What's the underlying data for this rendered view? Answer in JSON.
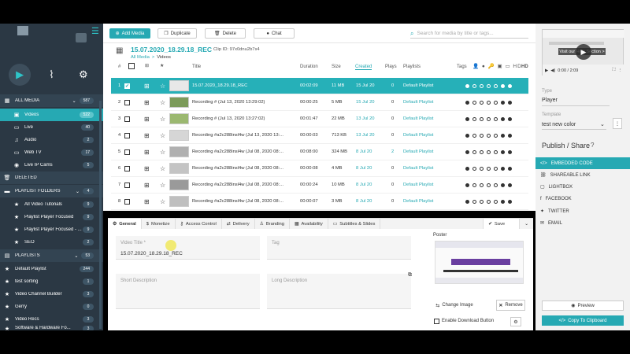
{
  "toolbar": {
    "add_label": "Add Media",
    "duplicate_label": "Duplicate",
    "delete_label": "Delete",
    "chat_label": "Chat",
    "search_placeholder": "Search for media by title or tags..."
  },
  "media": {
    "title": "15.07.2020_18.29.18_REC",
    "clip_id": "Clip ID: 97x0dnu2b7s4",
    "breadcrumb_root": "All Media",
    "breadcrumb_sep": ">",
    "breadcrumb_current": "Videos"
  },
  "table": {
    "headers": {
      "num": "#",
      "title": "Title",
      "duration": "Duration",
      "size": "Size",
      "created": "Created",
      "plays": "Plays",
      "playlists": "Playlists",
      "tags": "Tags",
      "hd": "HD"
    },
    "rows": [
      {
        "num": "1",
        "title": "15.07.2020_18.29.18_REC",
        "duration": "00:02:09",
        "size": "11 MB",
        "created": "15 Jul 20",
        "plays": "0",
        "playlist": "Default Playlist",
        "dots": [
          1,
          0,
          0,
          0,
          0,
          1,
          1
        ]
      },
      {
        "num": "2",
        "title": "Recording # (Jul 13, 2020 13:29:02)",
        "duration": "00:00:25",
        "size": "5 MB",
        "created": "15 Jul 20",
        "plays": "0",
        "playlist": "Default Playlist",
        "dots": [
          1,
          0,
          0,
          0,
          0,
          1,
          1
        ]
      },
      {
        "num": "3",
        "title": "Recording # (Jul 13, 2020 13:27:02)",
        "duration": "00:01:47",
        "size": "22 MB",
        "created": "13 Jul 20",
        "plays": "0",
        "playlist": "Default Playlist",
        "dots": [
          1,
          0,
          0,
          0,
          0,
          1,
          1
        ]
      },
      {
        "num": "4",
        "title": "Recording #a2c288insl4w (Jul 13, 2020 13:...",
        "duration": "00:00:03",
        "size": "713 KB",
        "created": "13 Jul 20",
        "plays": "0",
        "playlist": "Default Playlist",
        "dots": [
          1,
          0,
          0,
          0,
          0,
          1,
          1
        ]
      },
      {
        "num": "5",
        "title": "Recording #a2c288insl4w (Jul 08, 2020 08:...",
        "duration": "00:08:00",
        "size": "324 MB",
        "created": "8 Jul 20",
        "plays": "2",
        "playlist": "Default Playlist",
        "dots": [
          1,
          0,
          0,
          0,
          0,
          1,
          1
        ]
      },
      {
        "num": "6",
        "title": "Recording #a2c288insl4w (Jul 08, 2020 08:...",
        "duration": "00:00:08",
        "size": "4 MB",
        "created": "8 Jul 20",
        "plays": "0",
        "playlist": "Default Playlist",
        "dots": [
          1,
          0,
          0,
          0,
          0,
          1,
          1
        ]
      },
      {
        "num": "7",
        "title": "Recording #a2c288insl4w (Jul 08, 2020 08:...",
        "duration": "00:00:24",
        "size": "10 MB",
        "created": "8 Jul 20",
        "plays": "0",
        "playlist": "Default Playlist",
        "dots": [
          1,
          0,
          0,
          0,
          0,
          1,
          1
        ]
      },
      {
        "num": "8",
        "title": "Recording #a2c288insl4w (Jul 08, 2020 08:...",
        "duration": "00:00:07",
        "size": "3 MB",
        "created": "8 Jul 20",
        "plays": "0",
        "playlist": "Default Playlist",
        "dots": [
          1,
          0,
          0,
          0,
          0,
          1,
          1
        ]
      }
    ]
  },
  "sidebar": {
    "all_media": {
      "label": "ALL MEDIA",
      "count": "587"
    },
    "media_items": [
      {
        "label": "Videos",
        "count": "522"
      },
      {
        "label": "Live",
        "count": "40"
      },
      {
        "label": "Audio",
        "count": "2"
      },
      {
        "label": "Web TV",
        "count": "17"
      },
      {
        "label": "Live IP Cams",
        "count": "5"
      }
    ],
    "deleted": "DELETED",
    "playlist_folders": {
      "label": "PLAYLIST FOLDERS",
      "count": "4"
    },
    "folder_items": [
      {
        "label": "All Video Tutorials",
        "count": "9"
      },
      {
        "label": "Playlist Player Focused",
        "count": "9"
      },
      {
        "label": "Playlist Player Focused - ...",
        "count": "9"
      },
      {
        "label": "SEO",
        "count": "2"
      }
    ],
    "playlists": {
      "label": "PLAYLISTS",
      "count": "53"
    },
    "playlist_items": [
      {
        "label": "Default Playlist",
        "count": "244"
      },
      {
        "label": "test sorting",
        "count": "1"
      },
      {
        "label": "Video Channel Builder",
        "count": "3"
      },
      {
        "label": "Gerry",
        "count": "0"
      },
      {
        "label": "Video Recs",
        "count": "3"
      },
      {
        "label": "Software & Hardware Fo...",
        "count": "3"
      }
    ]
  },
  "tabs": {
    "general": "General",
    "monetize": "Monetize",
    "access": "Access Control",
    "delivery": "Delivery",
    "branding": "Branding",
    "availability": "Availability",
    "subtitles": "Subtitles & Slides",
    "save": "Save"
  },
  "form": {
    "title_label": "Video Title *",
    "title_value": "15.07.2020_18.29.18_REC",
    "tag_label": "Tag",
    "short_desc_label": "Short Description",
    "long_desc_label": "Long Description",
    "poster_label": "Poster",
    "change_image": "Change Image",
    "remove": "Remove",
    "enable_download": "Enable Download Button"
  },
  "right": {
    "video_time": "0:00 / 2:09",
    "video_overlay": "Visit our Help Section >",
    "type_label": "Type",
    "type_value": "Player",
    "template_label": "Template",
    "template_value": "test new color",
    "publish_title": "Publish / Share",
    "share_items": [
      "EMBEDDED CODE",
      "SHAREABLE LINK",
      "LIGHTBOX",
      "FACEBOOK",
      "TWITTER",
      "EMAIL"
    ],
    "preview": "Preview",
    "copy": "Copy To Clipboard"
  },
  "colors": {
    "accent": "#26a9b3",
    "sidebar_bg": "#2b3844"
  }
}
